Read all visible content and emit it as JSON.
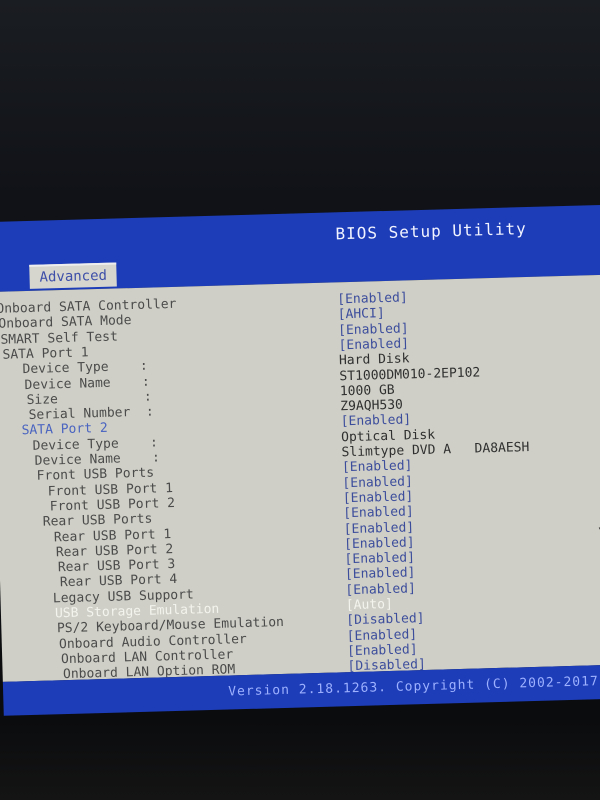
{
  "header": {
    "title": "BIOS Setup Utility",
    "active_tab": "Advanced"
  },
  "items": [
    {
      "label": "Onboard SATA Controller",
      "value": "[Enabled]",
      "indent": 0,
      "kind": "option"
    },
    {
      "label": "Onboard SATA Mode",
      "value": "[AHCI]",
      "indent": 0,
      "kind": "option"
    },
    {
      "label": "SMART Self Test",
      "value": "[Enabled]",
      "indent": 0,
      "kind": "option"
    },
    {
      "label": "SATA Port 1",
      "value": "[Enabled]",
      "indent": 0,
      "kind": "option"
    },
    {
      "label": "Device Type    :",
      "value": "Hard Disk",
      "indent": 2,
      "kind": "info"
    },
    {
      "label": "Device Name    :",
      "value": "ST1000DM010-2EP102",
      "indent": 2,
      "kind": "info"
    },
    {
      "label": "Size           :",
      "value": "1000 GB",
      "indent": 2,
      "kind": "info"
    },
    {
      "label": "Serial Number  :",
      "value": "Z9AQH530",
      "indent": 2,
      "kind": "info"
    },
    {
      "label": "SATA Port 2",
      "value": "[Enabled]",
      "indent": 1,
      "kind": "blue"
    },
    {
      "label": "Device Type    :",
      "value": "Optical Disk",
      "indent": 2,
      "kind": "info"
    },
    {
      "label": "Device Name    :",
      "value": "Slimtype DVD A   DA8AESH",
      "indent": 2,
      "kind": "info"
    },
    {
      "label": "Front USB Ports",
      "value": "[Enabled]",
      "indent": 2,
      "kind": "option"
    },
    {
      "label": "Front USB Port 1",
      "value": "[Enabled]",
      "indent": 3,
      "kind": "option"
    },
    {
      "label": "Front USB Port 2",
      "value": "[Enabled]",
      "indent": 3,
      "kind": "option"
    },
    {
      "label": "Rear USB Ports",
      "value": "[Enabled]",
      "indent": 2,
      "kind": "option"
    },
    {
      "label": "Rear USB Port 1",
      "value": "[Enabled]",
      "indent": 3,
      "kind": "option"
    },
    {
      "label": "Rear USB Port 2",
      "value": "[Enabled]",
      "indent": 3,
      "kind": "option"
    },
    {
      "label": "Rear USB Port 3",
      "value": "[Enabled]",
      "indent": 3,
      "kind": "option"
    },
    {
      "label": "Rear USB Port 4",
      "value": "[Enabled]",
      "indent": 3,
      "kind": "option"
    },
    {
      "label": "Legacy USB Support",
      "value": "[Enabled]",
      "indent": 2,
      "kind": "option"
    },
    {
      "label": "USB Storage Emulation",
      "value": "[Auto]",
      "indent": 2,
      "kind": "selected"
    },
    {
      "label": "PS/2 Keyboard/Mouse Emulation",
      "value": "[Disabled]",
      "indent": 2,
      "kind": "option"
    },
    {
      "label": "Onboard Audio Controller",
      "value": "[Enabled]",
      "indent": 2,
      "kind": "option"
    },
    {
      "label": "Onboard LAN Controller",
      "value": "[Enabled]",
      "indent": 2,
      "kind": "option"
    },
    {
      "label": "Onboard LAN Option ROM",
      "value": "[Disabled]",
      "indent": 2,
      "kind": "option"
    }
  ],
  "footer": {
    "version": "Version 2.18.1263. Copyright (C) 2002-2017."
  },
  "colors": {
    "header_blue": "#1d3db8",
    "panel_gray": "#cfcfc7",
    "value_blue": "#3c4d9c",
    "selected": "#f4f4ee"
  }
}
